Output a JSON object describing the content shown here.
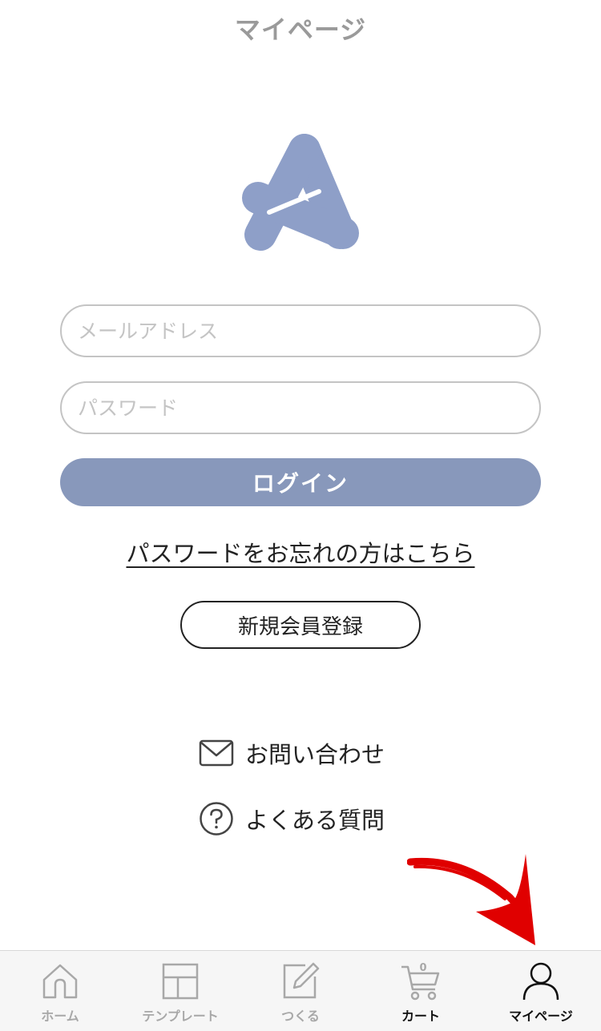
{
  "header": {
    "title": "マイページ"
  },
  "login_form": {
    "email_placeholder": "メールアドレス",
    "password_placeholder": "パスワード",
    "login_label": "ログイン",
    "forgot_password_label": "パスワードをお忘れの方はこちら",
    "register_label": "新規会員登録"
  },
  "support": {
    "contact_label": "お問い合わせ",
    "faq_label": "よくある質問"
  },
  "tabs": [
    {
      "label": "ホーム",
      "icon": "home-icon"
    },
    {
      "label": "テンプレート",
      "icon": "template-icon"
    },
    {
      "label": "つくる",
      "icon": "edit-icon"
    },
    {
      "label": "カート",
      "icon": "cart-icon",
      "badge": "0"
    },
    {
      "label": "マイページ",
      "icon": "user-icon"
    }
  ],
  "colors": {
    "accent": "#8898bb",
    "logo": "#8e9fc8",
    "annotation_arrow": "#e00000"
  }
}
